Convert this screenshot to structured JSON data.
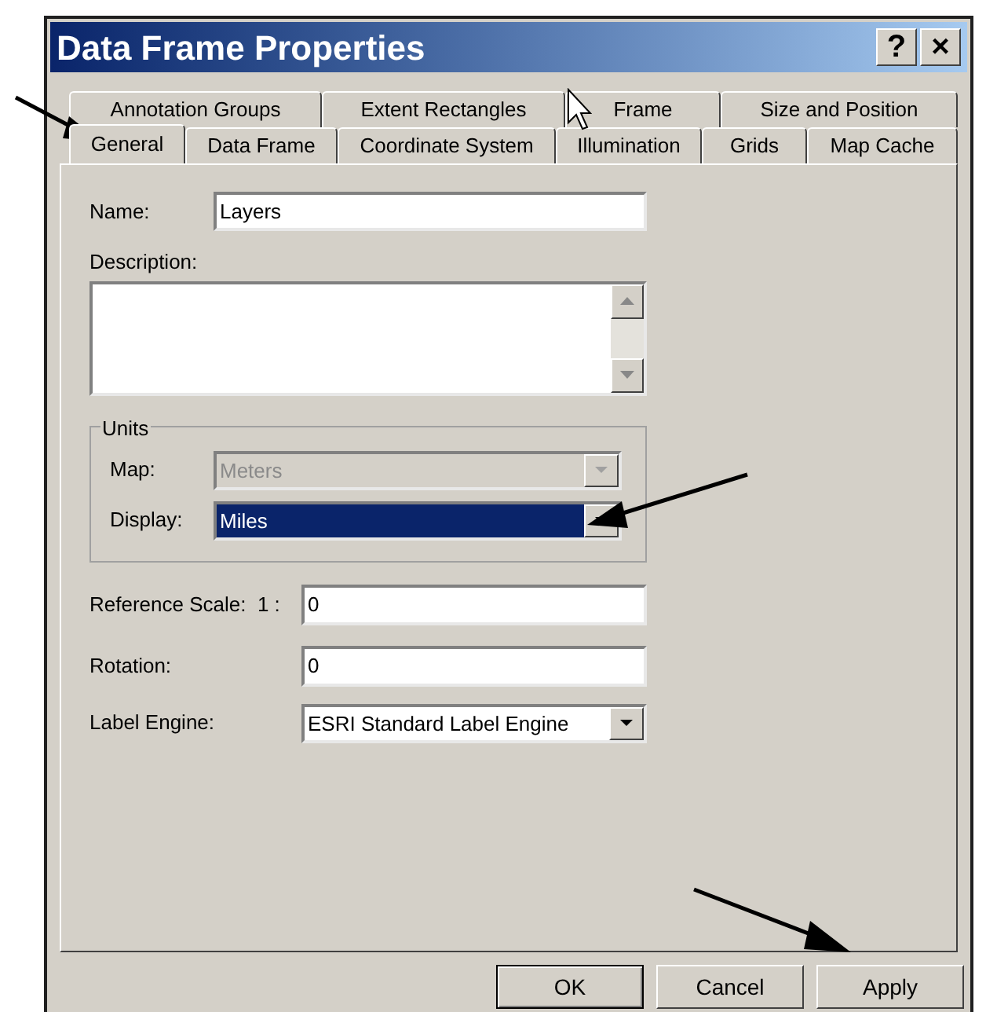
{
  "window": {
    "title": "Data Frame Properties",
    "title_buttons": [
      "?",
      "×"
    ]
  },
  "tab_rows": [
    [
      {
        "label": "Annotation Groups",
        "selected": false
      },
      {
        "label": "Extent Rectangles",
        "selected": false
      },
      {
        "label": "Frame",
        "selected": false
      },
      {
        "label": "Size and Position",
        "selected": false
      }
    ],
    [
      {
        "label": "General",
        "selected": true
      },
      {
        "label": "Data Frame",
        "selected": false
      },
      {
        "label": "Coordinate System",
        "selected": false
      },
      {
        "label": "Illumination",
        "selected": false
      },
      {
        "label": "Grids",
        "selected": false
      },
      {
        "label": "Map Cache",
        "selected": false
      }
    ]
  ],
  "general": {
    "name": {
      "label": "Name:",
      "value": "Layers"
    },
    "description": {
      "label": "Description:"
    },
    "units": {
      "title": "Units",
      "rows": [
        {
          "label": "Map:",
          "value": "Meters",
          "disabled": true,
          "focused": false
        },
        {
          "label": "Display:",
          "value": "Miles",
          "disabled": false,
          "focused": true
        }
      ]
    },
    "reference_scale": {
      "label": "Reference Scale:  1 :",
      "value": "0"
    },
    "rotation": {
      "label": "Rotation:",
      "value": "0"
    },
    "label_engine": {
      "label": "Label Engine:",
      "value": "ESRI Standard Label Engine"
    }
  },
  "buttons": [
    {
      "label": "OK",
      "default": true
    },
    {
      "label": "Cancel",
      "default": false
    },
    {
      "label": "Apply",
      "default": false
    }
  ]
}
